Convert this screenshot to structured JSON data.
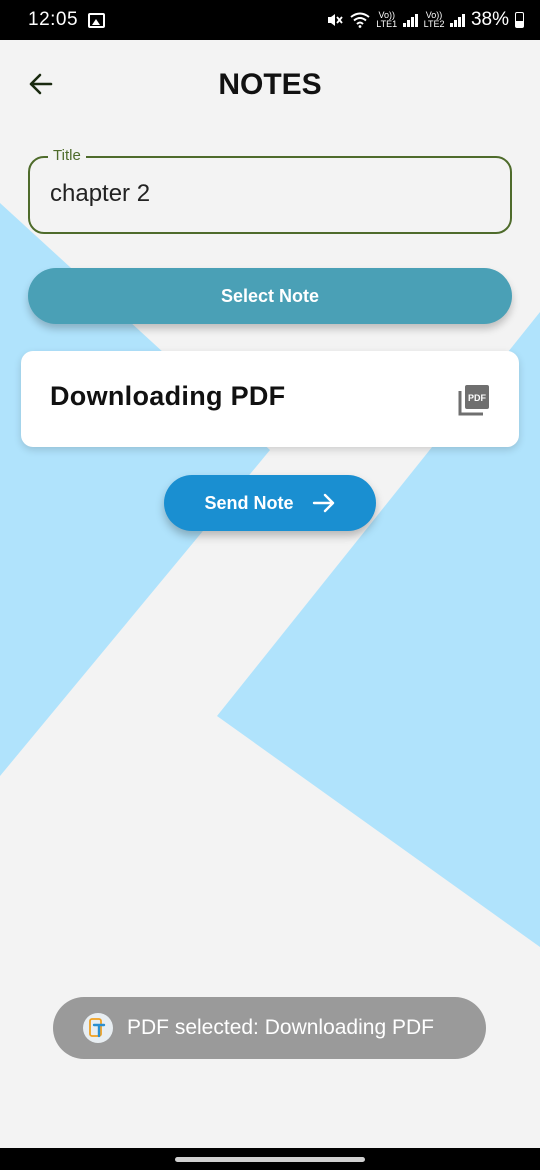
{
  "status_bar": {
    "time": "12:05",
    "lte1_label": "LTE1",
    "lte2_label": "LTE2",
    "volte_label": "Vo))",
    "battery": "38%"
  },
  "app_bar": {
    "title": "NOTES"
  },
  "title_field": {
    "label": "Title",
    "value": "chapter 2"
  },
  "select_button": {
    "label": "Select Note"
  },
  "note_card": {
    "name": "Downloading PDF",
    "icon": "picture-as-pdf-icon"
  },
  "send_button": {
    "label": "Send Note"
  },
  "toast": {
    "text": "PDF selected: Downloading PDF"
  },
  "colors": {
    "background": "#f3f3f3",
    "shape_light_blue": "#b0e3fc",
    "field_border": "#4e6b2b",
    "select_button": "#4aa0b6",
    "send_button": "#1a8fd1",
    "toast": "#9a9a9a"
  }
}
